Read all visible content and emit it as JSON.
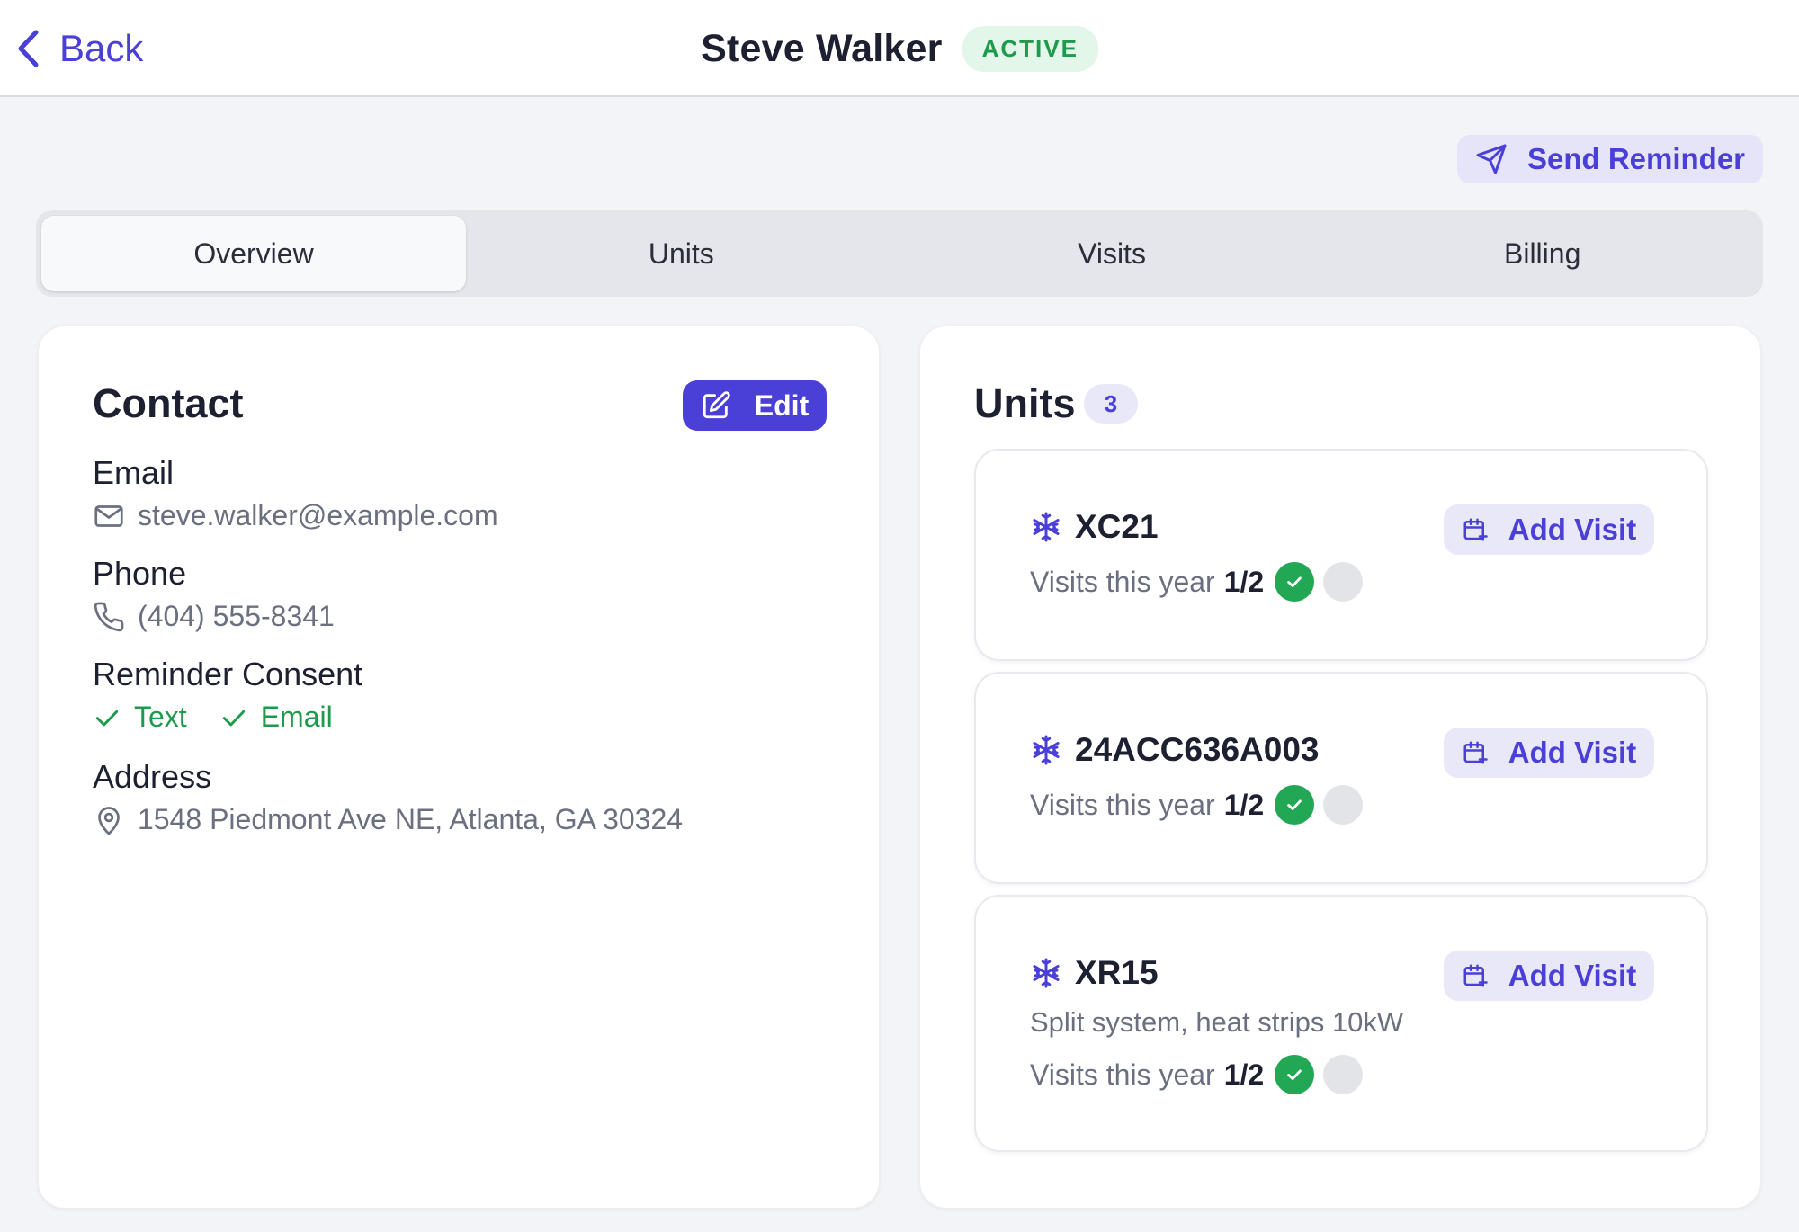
{
  "header": {
    "back_label": "Back",
    "customer_name": "Steve Walker",
    "status": "ACTIVE"
  },
  "actions": {
    "send_reminder_label": "Send Reminder"
  },
  "tabs": [
    {
      "label": "Overview",
      "active": true
    },
    {
      "label": "Units",
      "active": false
    },
    {
      "label": "Visits",
      "active": false
    },
    {
      "label": "Billing",
      "active": false
    }
  ],
  "contact": {
    "title": "Contact",
    "edit_label": "Edit",
    "email_label": "Email",
    "email": "steve.walker@example.com",
    "phone_label": "Phone",
    "phone": "(404) 555-8341",
    "consent_label": "Reminder Consent",
    "consent": [
      "Text",
      "Email"
    ],
    "address_label": "Address",
    "address": "1548 Piedmont Ave NE, Atlanta, GA 30324"
  },
  "units": {
    "title": "Units",
    "count": "3",
    "add_visit_label": "Add Visit",
    "visits_label": "Visits this year",
    "items": [
      {
        "name": "XC21",
        "description": "",
        "visits": "1/2",
        "completed": 1,
        "total": 2
      },
      {
        "name": "24ACC636A003",
        "description": "",
        "visits": "1/2",
        "completed": 1,
        "total": 2
      },
      {
        "name": "XR15",
        "description": "Split system, heat strips 10kW",
        "visits": "1/2",
        "completed": 1,
        "total": 2
      }
    ]
  },
  "colors": {
    "accent": "#4a3fd6",
    "success": "#1e9a4c",
    "background": "#f3f4f8"
  }
}
